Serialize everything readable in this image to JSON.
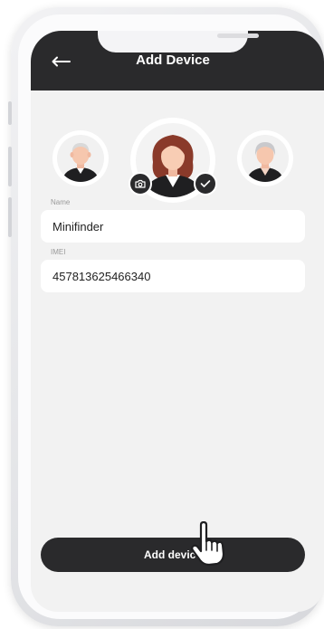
{
  "header": {
    "title": "Add Device",
    "back_icon": "arrow-left-icon"
  },
  "avatars": [
    {
      "name": "avatar-elderly-man",
      "selected": false
    },
    {
      "name": "avatar-woman",
      "selected": true
    },
    {
      "name": "avatar-elderly-woman",
      "selected": false
    }
  ],
  "badges": {
    "camera_icon": "camera-icon",
    "check_icon": "checkmark-icon"
  },
  "form": {
    "name_label": "Name",
    "name_value": "Minifinder",
    "imei_label": "IMEI",
    "imei_value": "457813625466340"
  },
  "actions": {
    "add_device_label": "Add device",
    "pointer_icon": "hand-pointer-icon"
  },
  "colors": {
    "header_bg": "#2a2a2c",
    "screen_bg": "#f2f2f2",
    "button_bg": "#2a2a2c",
    "field_bg": "#ffffff"
  }
}
